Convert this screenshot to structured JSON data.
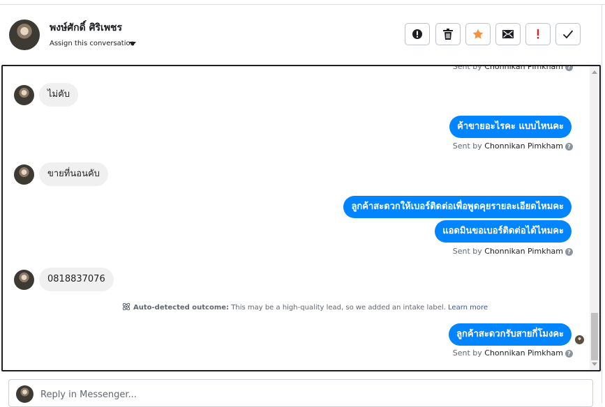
{
  "header": {
    "contact_name": "พงษ์ศักดิ์ ศิริเพชร",
    "assign_label": "Assign this conversation",
    "toolbar": [
      {
        "name": "mark-spam-button",
        "icon": "circle-exclamation-icon"
      },
      {
        "name": "delete-button",
        "icon": "trash-icon"
      },
      {
        "name": "star-button",
        "icon": "star-icon",
        "color": "#f7923b"
      },
      {
        "name": "mark-unread-button",
        "icon": "envelope-icon"
      },
      {
        "name": "follow-up-button",
        "icon": "exclamation-icon",
        "color": "#e02020"
      },
      {
        "name": "mark-done-button",
        "icon": "check-icon"
      }
    ]
  },
  "sent_by_prefix": "Sent by",
  "agent_name": "Chonnikan Pimkham",
  "messages": [
    {
      "dir": "in",
      "text": "ไม่คับ"
    },
    {
      "dir": "out",
      "text": "ค้าขายอะไรคะ แบบไหนคะ"
    },
    {
      "dir": "in",
      "text": "ขายที่นอนคับ"
    },
    {
      "dir": "out",
      "text": "ลูกค้าสะดวกให้เบอร์ติดต่อเพื่อพูดคุยรายละเอียดไหมคะ"
    },
    {
      "dir": "out",
      "text": "แอดมินขอเบอร์ติดต่อได้ไหมคะ"
    },
    {
      "dir": "in",
      "text": "0818837076"
    },
    {
      "dir": "out",
      "text": "ลูกค้าสะดวกรับสายกี่โมงคะ"
    }
  ],
  "auto_detected": {
    "label": "Auto-detected outcome:",
    "text": "This may be a high-quality lead, so we added an intake label.",
    "link": "Learn more"
  },
  "reply": {
    "placeholder": "Reply in Messenger..."
  },
  "colors": {
    "outgoing_bubble": "#0084ff",
    "incoming_bubble": "#f1f0f0"
  }
}
